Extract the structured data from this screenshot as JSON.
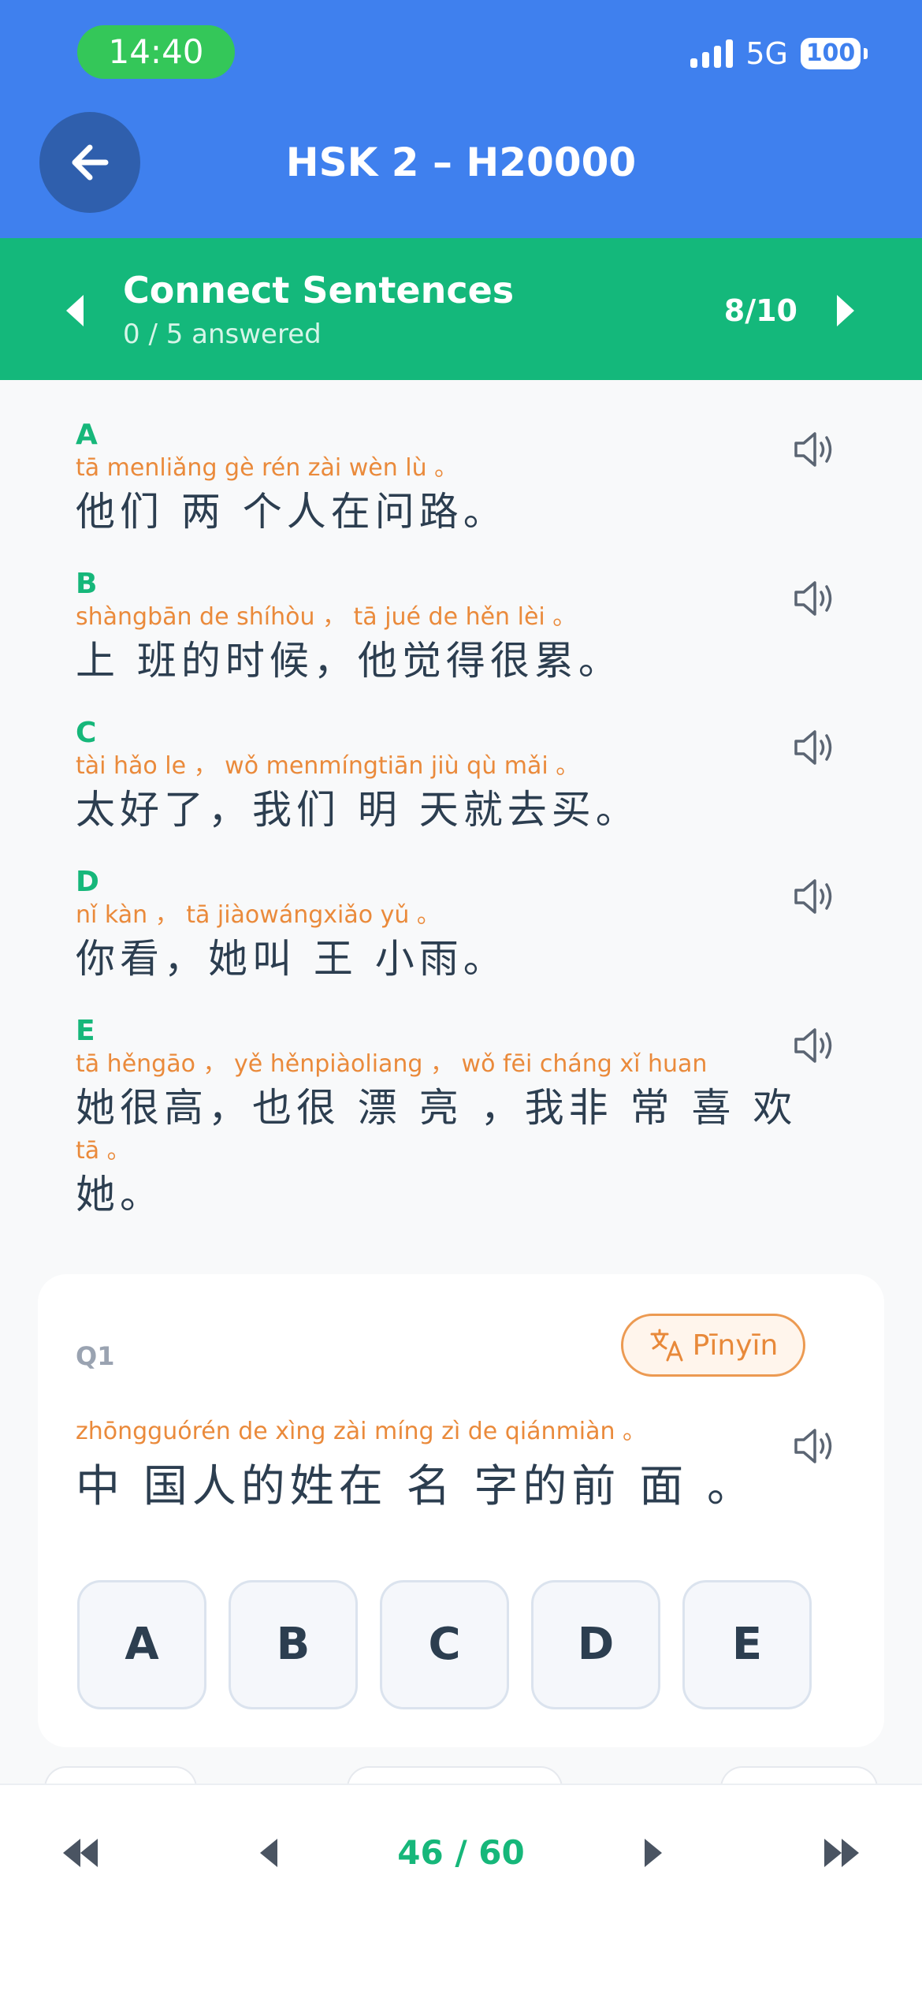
{
  "status_bar": {
    "time": "14:40",
    "network": "5G",
    "battery": "100"
  },
  "header": {
    "title": "HSK 2 – H20000"
  },
  "section": {
    "title": "Connect Sentences",
    "subtitle": "0 / 5 answered",
    "counter": "8/10"
  },
  "options": [
    {
      "letter": "A",
      "pinyin": " tā menliǎng gè rén zài wèn lù  。",
      "hanzi": "他们 两 个人在问路。"
    },
    {
      "letter": "B",
      "pinyin": "shàngbān de shíhòu ，  tā  jué de hěn lèi  。",
      "hanzi": " 上 班的时候，他觉得很累。"
    },
    {
      "letter": "C",
      "pinyin": " tài hǎo  le  ，  wǒ menmíngtiān jiù  qù mǎi 。",
      "hanzi": "太好了，我们 明 天就去买。"
    },
    {
      "letter": "D",
      "pinyin": " nǐ kàn ，  tā  jiàowángxiǎo yǔ  。",
      "hanzi": "你看，她叫 王 小雨。"
    },
    {
      "letter": "E",
      "pinyin": " tā  hěngāo ，  yě  hěnpiàoliang ，  wǒ fēi cháng  xǐ  huan",
      "hanzi": "她很高，也很 漂 亮 ，我非 常 喜 欢",
      "pinyin2": " tā  。",
      "hanzi2": "她。"
    }
  ],
  "question": {
    "label": "Q1",
    "pinyin_button": "Pīnyīn",
    "pinyin": "zhōngguórén  de  xìng zài míng  zì   de  qiánmiàn  。",
    "hanzi": " 中 国人的姓在 名 字的前 面 。",
    "choices": [
      "A",
      "B",
      "C",
      "D",
      "E"
    ]
  },
  "bottom_nav": {
    "page": "46 / 60"
  },
  "colors": {
    "header_blue": "#3f80ee",
    "section_green": "#14b87b",
    "pinyin_orange": "#ea8a3b",
    "accent_green": "#16b77a"
  },
  "icons": [
    "back-arrow-icon",
    "chevron-left-icon",
    "chevron-right-icon",
    "speaker-icon",
    "translate-icon",
    "skip-first-icon",
    "skip-last-icon"
  ]
}
